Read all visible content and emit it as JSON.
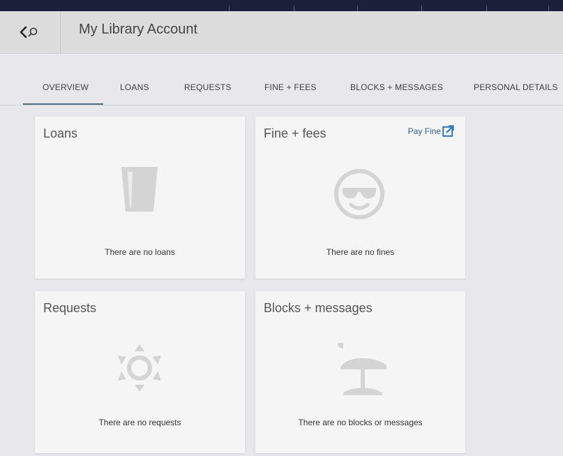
{
  "header": {
    "title": "My Library Account"
  },
  "tabs": [
    {
      "label": "OVERVIEW",
      "selected": true
    },
    {
      "label": "LOANS",
      "selected": false
    },
    {
      "label": "REQUESTS",
      "selected": false
    },
    {
      "label": "FINE + FEES",
      "selected": false
    },
    {
      "label": "BLOCKS + MESSAGES",
      "selected": false
    },
    {
      "label": "PERSONAL DETAILS",
      "selected": false
    }
  ],
  "cards": {
    "loans": {
      "title": "Loans",
      "message": "There are no loans",
      "icon": "empty-glass-icon"
    },
    "fines": {
      "title": "Fine + fees",
      "message": "There are no fines",
      "icon": "sunglasses-smiley-icon",
      "action_label": "Pay Fine"
    },
    "requests": {
      "title": "Requests",
      "message": "There are no requests",
      "icon": "sun-icon"
    },
    "blocks": {
      "title": "Blocks + messages",
      "message": "There are no blocks or messages",
      "icon": "beach-umbrella-icon"
    }
  },
  "colors": {
    "accent": "#4f6e86",
    "link": "#2c5f8a",
    "icon_gray": "#d4d4d4"
  }
}
